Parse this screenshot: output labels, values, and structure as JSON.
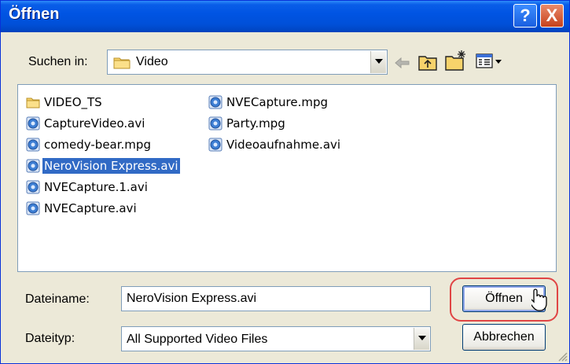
{
  "dialog": {
    "title": "Öffnen",
    "help_glyph": "?",
    "close_glyph": "X"
  },
  "look_in": {
    "label": "Suchen in:",
    "value": "Video"
  },
  "toolbar": {
    "icons": [
      "back-arrow-icon",
      "up-folder-icon",
      "new-folder-icon",
      "view-menu-icon"
    ]
  },
  "files": {
    "column1": [
      {
        "name": "VIDEO_TS",
        "icon": "folder-icon",
        "selected": false
      },
      {
        "name": "CaptureVideo.avi",
        "icon": "media-file-icon",
        "selected": false
      },
      {
        "name": "comedy-bear.mpg",
        "icon": "media-file-icon",
        "selected": false
      },
      {
        "name": "NeroVision Express.avi",
        "icon": "media-file-icon",
        "selected": true
      },
      {
        "name": "NVECapture.1.avi",
        "icon": "media-file-icon",
        "selected": false
      },
      {
        "name": "NVECapture.avi",
        "icon": "media-file-icon",
        "selected": false
      }
    ],
    "column2": [
      {
        "name": "NVECapture.mpg",
        "icon": "media-file-icon",
        "selected": false
      },
      {
        "name": "Party.mpg",
        "icon": "media-file-icon",
        "selected": false
      },
      {
        "name": "Videoaufnahme.avi",
        "icon": "media-file-icon",
        "selected": false
      }
    ]
  },
  "filename": {
    "label": "Dateiname:",
    "value": "NeroVision Express.avi"
  },
  "filetype": {
    "label": "Dateityp:",
    "value": "All Supported Video Files"
  },
  "buttons": {
    "open": "Öffnen",
    "cancel": "Abbrechen"
  },
  "colors": {
    "titlebar": "#0054e3",
    "selection": "#316ac5",
    "highlight_ring": "#e04545"
  }
}
